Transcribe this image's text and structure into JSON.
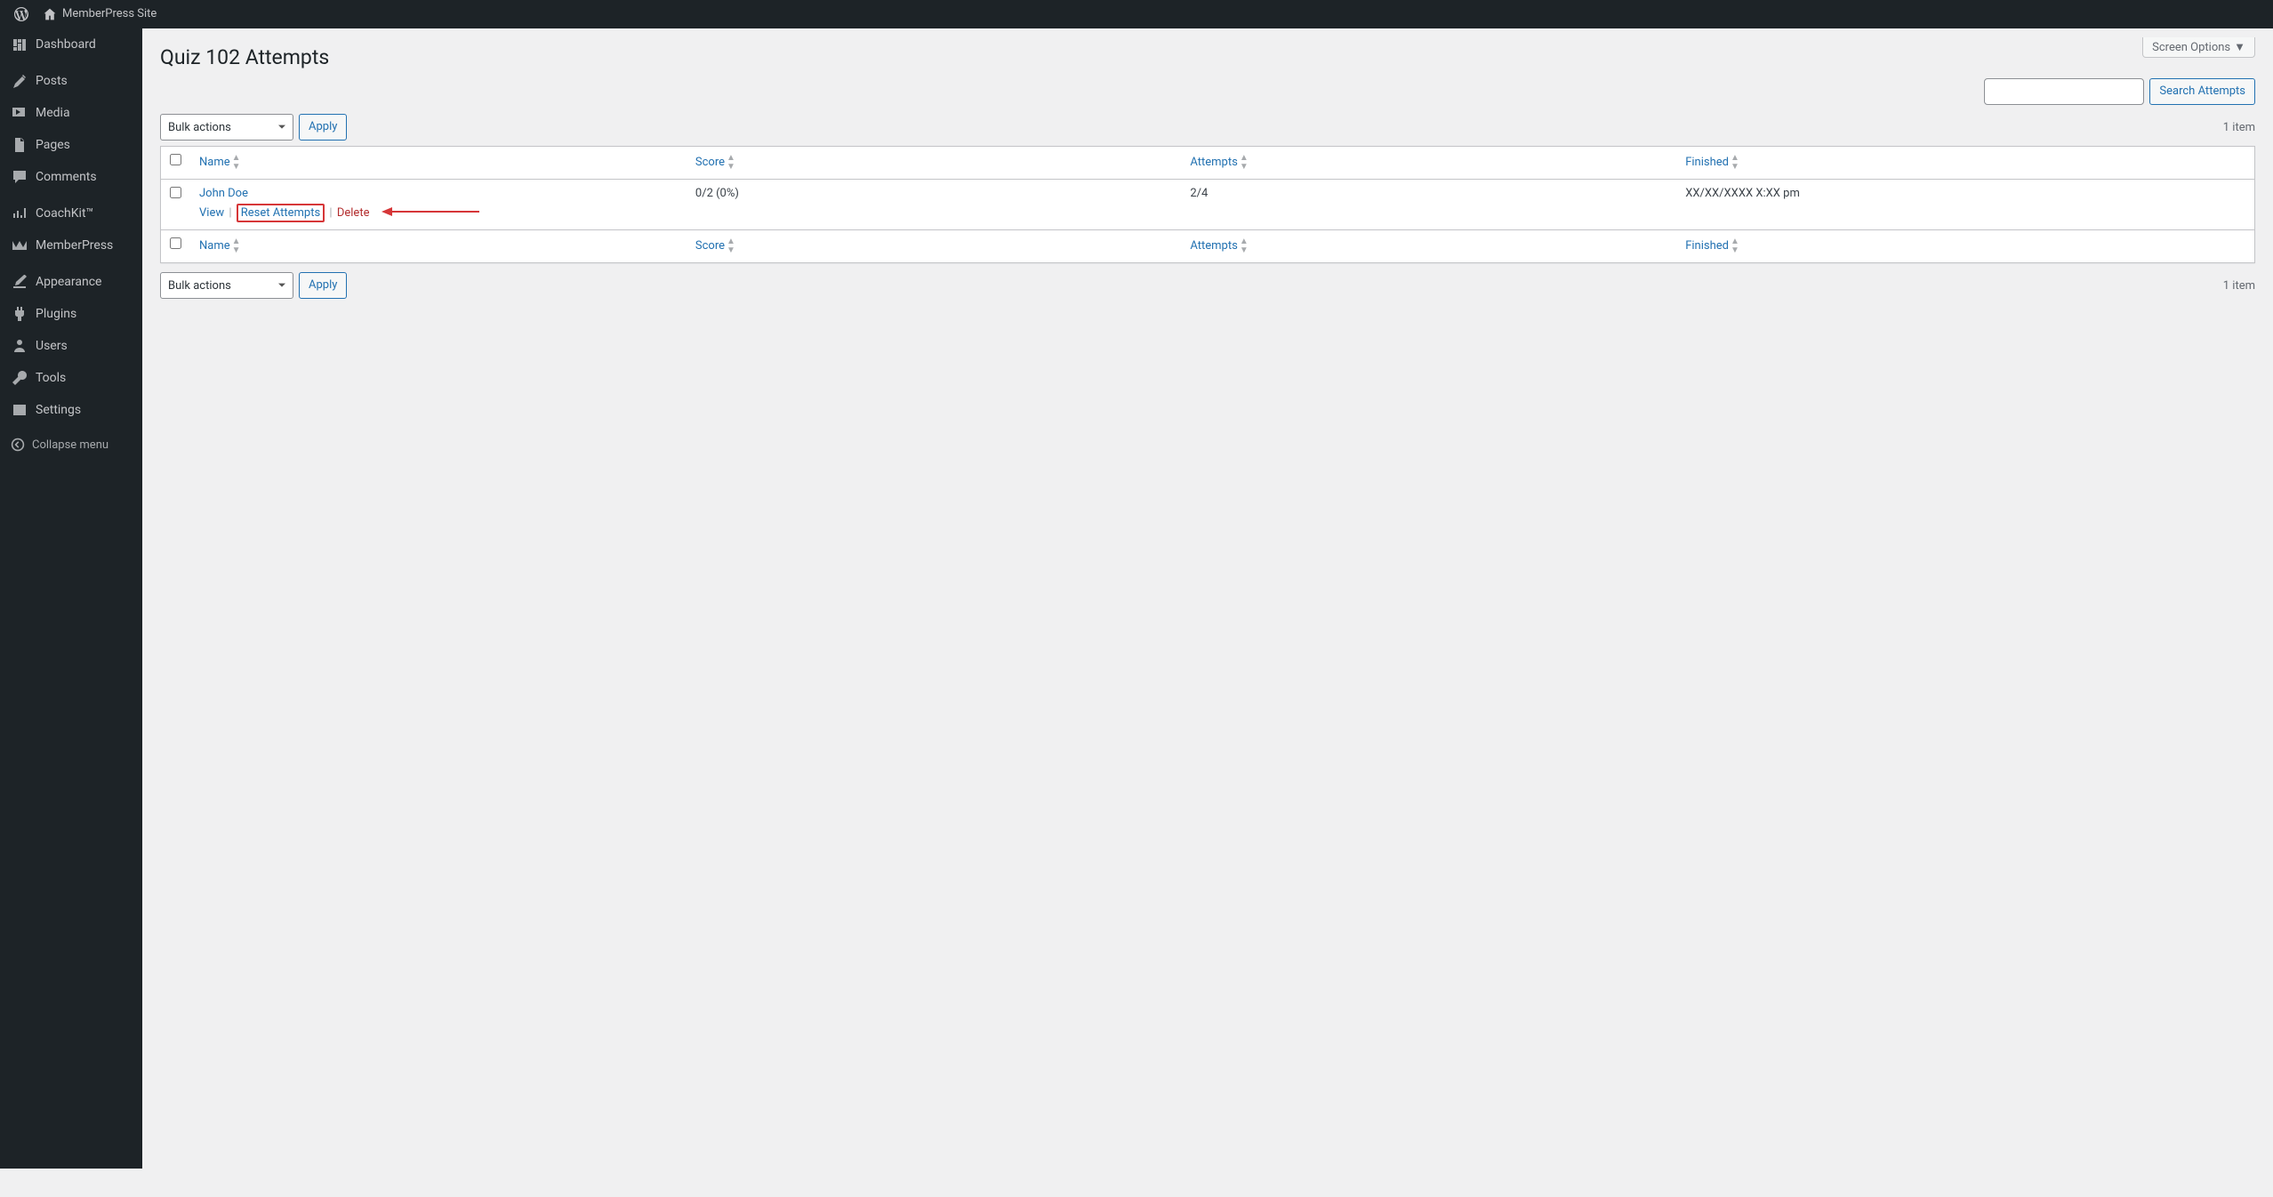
{
  "adminbar": {
    "site_name": "MemberPress Site"
  },
  "sidebar": {
    "items": [
      {
        "label": "Dashboard"
      },
      {
        "label": "Posts"
      },
      {
        "label": "Media"
      },
      {
        "label": "Pages"
      },
      {
        "label": "Comments"
      },
      {
        "label": "CoachKit™"
      },
      {
        "label": "MemberPress"
      },
      {
        "label": "Appearance"
      },
      {
        "label": "Plugins"
      },
      {
        "label": "Users"
      },
      {
        "label": "Tools"
      },
      {
        "label": "Settings"
      }
    ],
    "collapse_label": "Collapse menu"
  },
  "header": {
    "page_title": "Quiz 102 Attempts",
    "screen_options_label": "Screen Options"
  },
  "search": {
    "input_value": "",
    "button_label": "Search Attempts"
  },
  "bulk": {
    "select_label": "Bulk actions",
    "apply_label": "Apply"
  },
  "counts": {
    "top": "1 item",
    "bottom": "1 item"
  },
  "table": {
    "columns": {
      "name": "Name",
      "score": "Score",
      "attempts": "Attempts",
      "finished": "Finished"
    },
    "rows": [
      {
        "name": "John Doe",
        "score": "0/2 (0%)",
        "attempts": "2/4",
        "finished": "XX/XX/XXXX X:XX pm",
        "actions": {
          "view": "View",
          "reset": "Reset Attempts",
          "delete": "Delete"
        }
      }
    ]
  }
}
